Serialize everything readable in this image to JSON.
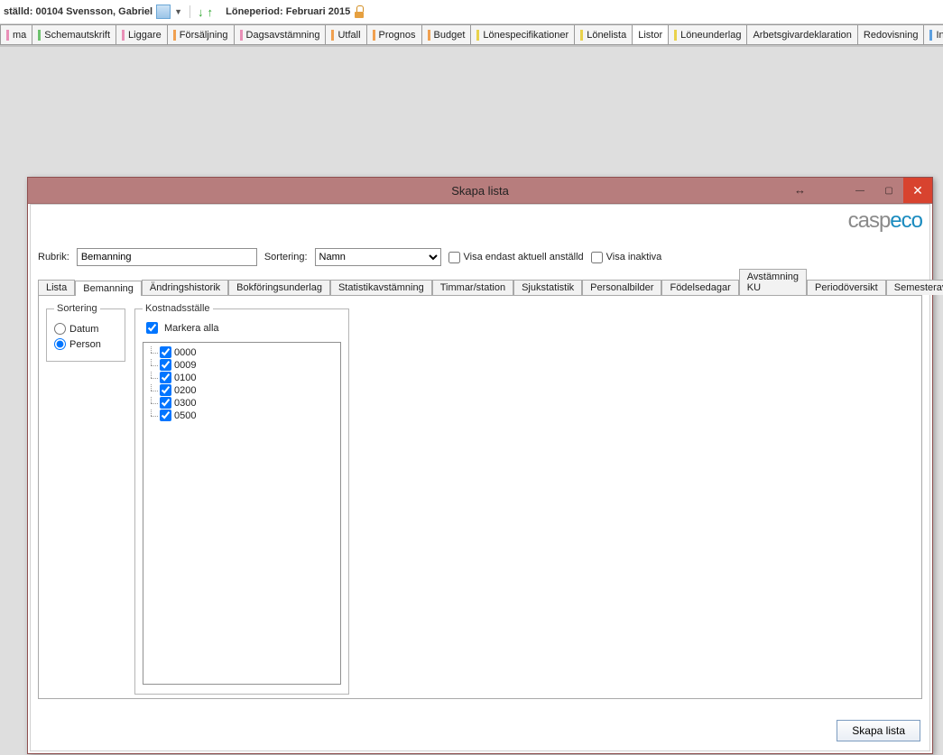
{
  "header": {
    "employee_label": "ställd: 00104 Svensson, Gabriel",
    "period_label": "Löneperiod: Februari 2015"
  },
  "main_tabs": [
    {
      "label": "ma",
      "color": "c-pink"
    },
    {
      "label": "Schemautskrift",
      "color": "c-green"
    },
    {
      "label": "Liggare",
      "color": "c-pink"
    },
    {
      "label": "Försäljning",
      "color": "c-orange"
    },
    {
      "label": "Dagsavstämning",
      "color": "c-pink"
    },
    {
      "label": "Utfall",
      "color": "c-orange"
    },
    {
      "label": "Prognos",
      "color": "c-orange"
    },
    {
      "label": "Budget",
      "color": "c-orange"
    },
    {
      "label": "Lönespecifikationer",
      "color": "c-yellow"
    },
    {
      "label": "Lönelista",
      "color": "c-yellow"
    },
    {
      "label": "Listor",
      "color": "",
      "active": true
    },
    {
      "label": "Löneunderlag",
      "color": "c-yellow"
    },
    {
      "label": "Arbetsgivardeklaration",
      "color": ""
    },
    {
      "label": "Redovisning",
      "color": ""
    },
    {
      "label": "Intyg & blanketter",
      "color": "c-blue"
    }
  ],
  "dialog": {
    "title": "Skapa lista",
    "logo_gray": "casp",
    "logo_blue": "eco",
    "rubrik_label": "Rubrik:",
    "rubrik_value": "Bemanning",
    "sortering_label": "Sortering:",
    "sortering_value": "Namn",
    "show_current_label": "Visa endast aktuell anställd",
    "show_inactive_label": "Visa inaktiva",
    "create_button": "Skapa lista"
  },
  "inner_tabs": [
    "Lista",
    "Bemanning",
    "Ändringshistorik",
    "Bokföringsunderlag",
    "Statistikavstämning",
    "Timmar/station",
    "Sjukstatistik",
    "Personalbilder",
    "Födelsedagar",
    "Avstämning KU",
    "Periodöversikt",
    "Semesteravstämning"
  ],
  "inner_active_index": 1,
  "sort_group": {
    "legend": "Sortering",
    "opt_datum": "Datum",
    "opt_person": "Person",
    "selected": "person"
  },
  "kost_group": {
    "legend": "Kostnadsställe",
    "mark_all": "Markera alla",
    "items": [
      "0000",
      "0009",
      "0100",
      "0200",
      "0300",
      "0500"
    ]
  }
}
